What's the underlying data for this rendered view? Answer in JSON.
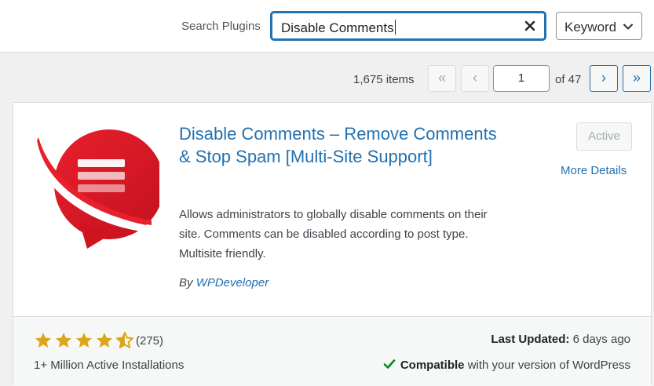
{
  "search": {
    "label": "Search Plugins",
    "value": "Disable Comments",
    "type_selected": "Keyword"
  },
  "pagination": {
    "items": "1,675 items",
    "first": "«",
    "prev": "‹",
    "current_page": "1",
    "of_pages": "of 47",
    "next": "›",
    "last": "»"
  },
  "plugin": {
    "title": "Disable Comments – Remove Comments & Stop Spam [Multi-Site Support]",
    "description": "Allows administrators to globally disable comments on their site. Comments can be disabled according to post type. Multisite friendly.",
    "author_prefix": "By",
    "author": "WPDeveloper",
    "action_button": "Active",
    "more_details": "More Details",
    "rating": 4.5,
    "rating_max": 5,
    "rating_count": "(275)",
    "installs": "1+ Million Active Installations",
    "last_updated_label": "Last Updated:",
    "last_updated_value": "6 days ago",
    "compat_label": "Compatible",
    "compat_rest": "with your version of WordPress"
  },
  "colors": {
    "accent": "#2271b1",
    "star": "#dba617",
    "logo_red": "#e0202e",
    "check": "#008a20"
  },
  "icons": {
    "clear": "close-icon",
    "dropdown": "chevron-down-icon",
    "compatible": "check-icon",
    "star": "star-icon",
    "logo": "plugin-logo"
  }
}
